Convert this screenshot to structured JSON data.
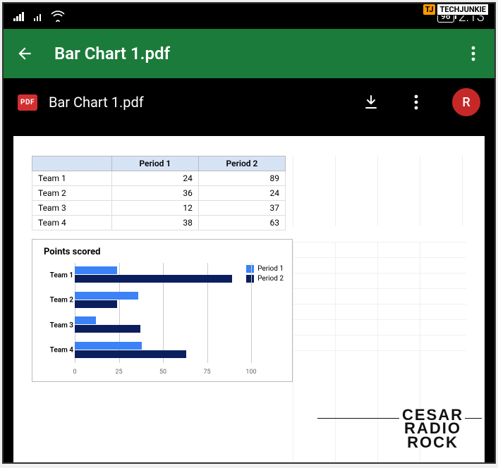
{
  "watermarks": {
    "top_badge_j": "TJ",
    "top_badge_text": "TECHJUNKIE",
    "bottom_line1": "CESAR",
    "bottom_line2": "RADIO",
    "bottom_line3": "ROCK"
  },
  "status_bar": {
    "battery": "96",
    "time": "2:13"
  },
  "app_bar": {
    "title": "Bar Chart 1.pdf"
  },
  "file_row": {
    "badge": "PDF",
    "name": "Bar Chart 1.pdf",
    "avatar_initial": "R"
  },
  "chart_data": {
    "type": "bar",
    "title": "Points scored",
    "orientation": "horizontal",
    "categories": [
      "Team 1",
      "Team 2",
      "Team 3",
      "Team 4"
    ],
    "series": [
      {
        "name": "Period 1",
        "values": [
          24,
          36,
          12,
          38
        ],
        "color": "#3b82f6"
      },
      {
        "name": "Period 2",
        "values": [
          89,
          24,
          37,
          63
        ],
        "color": "#0b1f5e"
      }
    ],
    "xlabel": "",
    "ylabel": "",
    "xlim": [
      0,
      100
    ],
    "xticks": [
      0,
      25,
      50,
      75,
      100
    ],
    "table": {
      "columns": [
        "",
        "Period 1",
        "Period 2"
      ],
      "rows": [
        [
          "Team 1",
          24,
          89
        ],
        [
          "Team 2",
          36,
          24
        ],
        [
          "Team 3",
          12,
          37
        ],
        [
          "Team 4",
          38,
          63
        ]
      ]
    },
    "legend_position": "top-right"
  }
}
